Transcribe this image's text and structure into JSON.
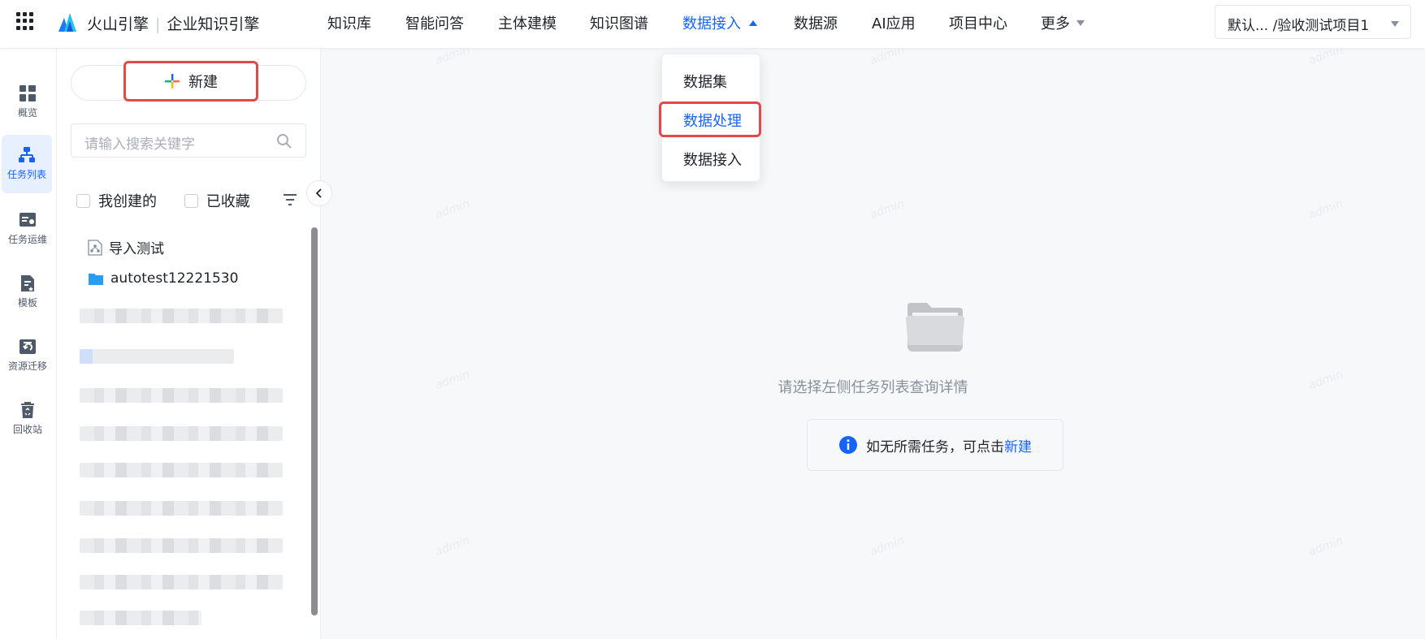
{
  "brand": {
    "name": "火山引擎",
    "product": "企业知识引擎"
  },
  "nav": [
    {
      "label": "知识库"
    },
    {
      "label": "智能问答"
    },
    {
      "label": "主体建模"
    },
    {
      "label": "知识图谱"
    },
    {
      "label": "数据接入"
    },
    {
      "label": "数据源"
    },
    {
      "label": "AI应用"
    },
    {
      "label": "项目中心"
    },
    {
      "label": "更多"
    }
  ],
  "project_selector": {
    "value": "默认... /验收测试项目1"
  },
  "rail": [
    {
      "label": "概览",
      "icon": "grid-icon"
    },
    {
      "label": "任务列表",
      "icon": "flow-icon"
    },
    {
      "label": "任务运维",
      "icon": "ops-icon"
    },
    {
      "label": "模板",
      "icon": "template-icon"
    },
    {
      "label": "资源迁移",
      "icon": "migrate-icon"
    },
    {
      "label": "回收站",
      "icon": "trash-icon"
    }
  ],
  "panel": {
    "new_label": "新建",
    "search_placeholder": "请输入搜索关键字",
    "filter_mine": "我创建的",
    "filter_fav": "已收藏",
    "tree": [
      {
        "label": "导入测试",
        "icon": "task-file-icon"
      },
      {
        "label": "autotest12221530",
        "icon": "folder-icon"
      }
    ]
  },
  "main": {
    "empty_text": "请选择左侧任务列表查询详情",
    "tip_text": "如无所需任务，可点击",
    "tip_link": "新建",
    "watermark": "admin"
  },
  "dropdown": [
    {
      "label": "数据集"
    },
    {
      "label": "数据处理"
    },
    {
      "label": "数据接入"
    }
  ],
  "colors": {
    "accent": "#1664ff",
    "highlight": "#e04a4a"
  }
}
